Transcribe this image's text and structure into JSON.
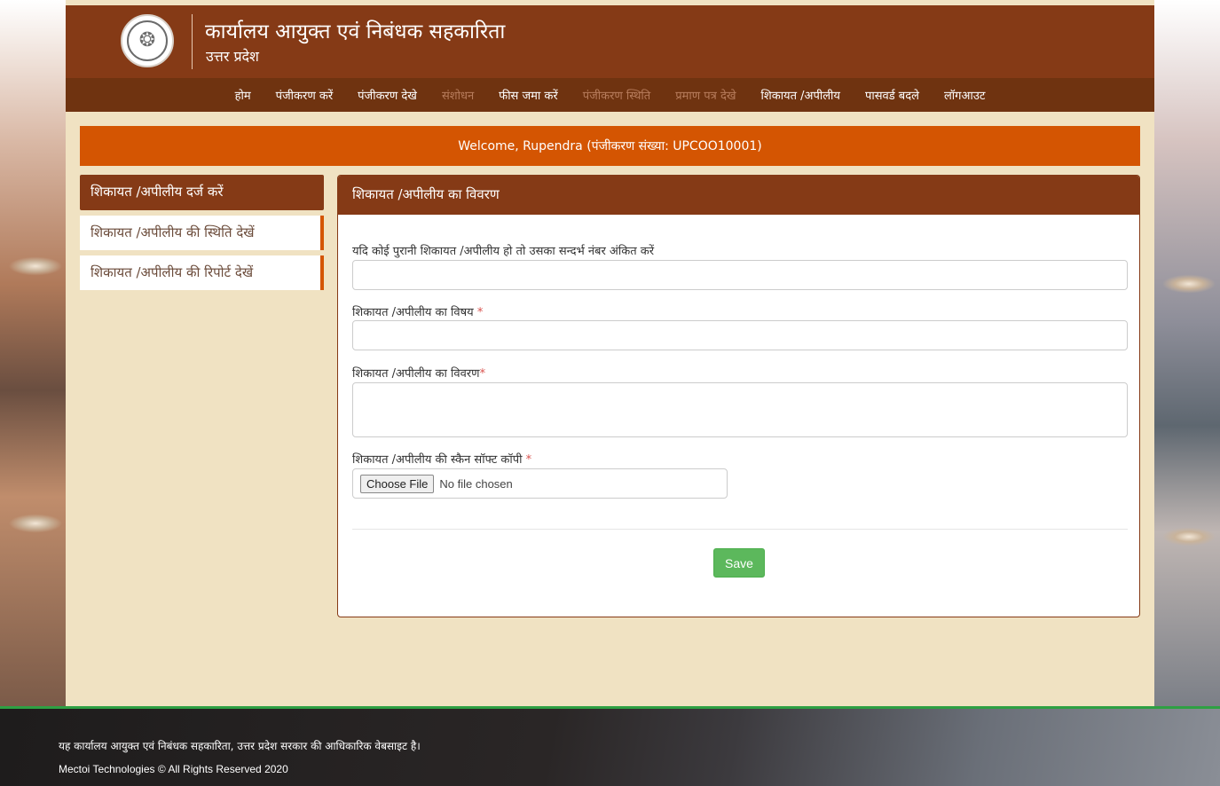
{
  "header": {
    "title": "कार्यालय आयुक्त एवं निबंधक सहकारिता",
    "subtitle": "उत्तर प्रदेश"
  },
  "nav": [
    {
      "label": "होम",
      "enabled": true
    },
    {
      "label": "पंजीकरण करें",
      "enabled": true
    },
    {
      "label": "पंजीकरण देखे",
      "enabled": true
    },
    {
      "label": "संशोधन",
      "enabled": false
    },
    {
      "label": "फीस जमा करें",
      "enabled": true
    },
    {
      "label": "पंजीकरण स्थिति",
      "enabled": false
    },
    {
      "label": "प्रमाण पत्र देखे",
      "enabled": false
    },
    {
      "label": "शिकायत /अपीलीय",
      "enabled": true
    },
    {
      "label": "पासवर्ड बदले",
      "enabled": true
    },
    {
      "label": "लॉगआउट",
      "enabled": true
    }
  ],
  "welcome": "Welcome, Rupendra (पंजीकरण संख्या: UPCOO10001)",
  "sidebar": {
    "active": "शिकायत /अपीलीय दर्ज करें",
    "items": [
      "शिकायत /अपीलीय की स्थिति देखें",
      "शिकायत /अपीलीय की रिपोर्ट देखें"
    ]
  },
  "panel": {
    "title": "शिकायत /अपीलीय का विवरण",
    "ref_label": "यदि कोई पुरानी शिकायत /अपीलीय हो तो उसका सन्दर्भ नंबर अंकित करें",
    "subject_label": "शिकायत /अपीलीय का विषय ",
    "detail_label": "शिकायत /अपीलीय का विवरण",
    "file_label": "शिकायत /अपीलीय की स्कैन सॉफ्ट कॉपी ",
    "required_mark": "*",
    "file_button": "Choose File",
    "file_status": "No file chosen",
    "save_label": "Save"
  },
  "footer": {
    "line1": "यह कार्यालय आयुक्त एवं निबंधक सहकारिता, उत्तर प्रदेश सरकार की आधिकारिक वेबसाइट है।",
    "line2": "Mectoi Technologies © All Rights Reserved 2020"
  },
  "colors": {
    "header": "#853a16",
    "nav": "#6f3310",
    "welcome": "#d45502",
    "page": "#f0e2c2",
    "save": "#5cb85c"
  }
}
